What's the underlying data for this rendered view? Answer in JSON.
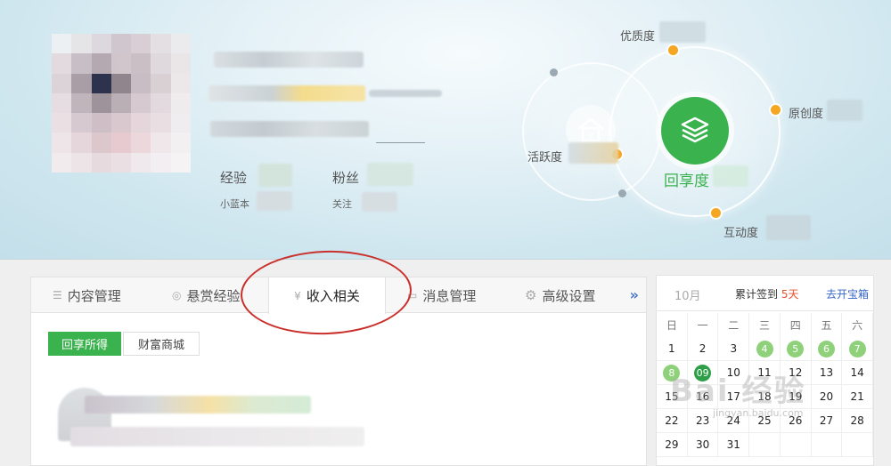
{
  "profile": {
    "stats": [
      {
        "label": "经验",
        "sub": "小蓝本"
      },
      {
        "label": "粉丝",
        "sub": "关注"
      }
    ]
  },
  "radar": {
    "core_label": "回享度",
    "labels": {
      "quality": "优质度",
      "originality": "原创度",
      "activity": "活跃度",
      "interaction": "互动度"
    }
  },
  "tabs": [
    {
      "label": "内容管理",
      "icon": "list-icon"
    },
    {
      "label": "悬赏经验",
      "icon": "bounty-icon"
    },
    {
      "label": "收入相关",
      "icon": "yen-icon",
      "active": true
    },
    {
      "label": "消息管理",
      "icon": "message-icon"
    },
    {
      "label": "高级设置",
      "icon": "gear-icon"
    }
  ],
  "tabs_more": "»",
  "subtabs": [
    "回享所得",
    "财富商城"
  ],
  "calendar": {
    "month": "10月",
    "signed_prefix": "累计签到",
    "signed_days": "5天",
    "treasure": "去开宝箱",
    "weekdays": [
      "日",
      "一",
      "二",
      "三",
      "四",
      "五",
      "六"
    ],
    "weeks": [
      [
        1,
        2,
        3,
        4,
        5,
        6,
        7
      ],
      [
        8,
        9,
        10,
        11,
        12,
        13,
        14
      ],
      [
        15,
        16,
        17,
        18,
        19,
        20,
        21
      ],
      [
        22,
        23,
        24,
        25,
        26,
        27,
        28
      ],
      [
        29,
        30,
        31,
        "",
        "",
        "",
        ""
      ]
    ],
    "signed": [
      4,
      5,
      6,
      7,
      8
    ],
    "today": 9
  },
  "watermark": "Bai 经验",
  "watermark_url": "jingyan.baidu.com",
  "colors": {
    "accent": "#3ab24d",
    "annotation": "#c9302c",
    "link": "#3665c7",
    "highlight": "#e0522c"
  }
}
